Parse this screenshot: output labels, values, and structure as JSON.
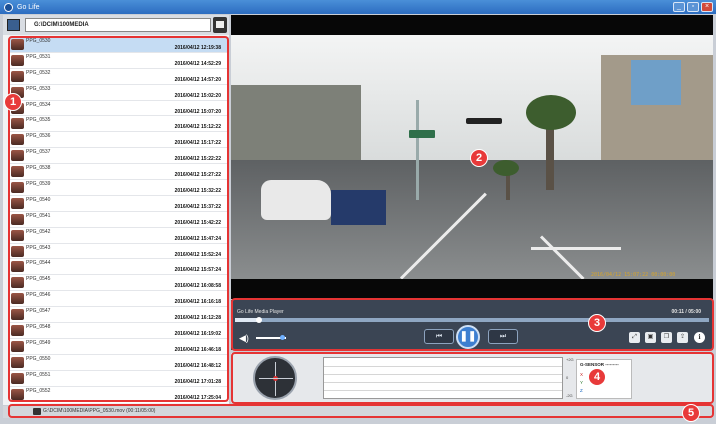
{
  "window": {
    "title": "Go Life",
    "controls": [
      "_",
      "▫",
      "×"
    ]
  },
  "directory": {
    "path": "G:\\DCIM\\100MEDIA"
  },
  "files": [
    {
      "name": "PPG_0530",
      "date": "2016/04/12 12:19:38"
    },
    {
      "name": "PPG_0531",
      "date": "2016/04/12 14:52:29"
    },
    {
      "name": "PPG_0532",
      "date": "2016/04/12 14:57:20"
    },
    {
      "name": "PPG_0533",
      "date": "2016/04/12 15:02:20"
    },
    {
      "name": "PPG_0534",
      "date": "2016/04/12 15:07:20"
    },
    {
      "name": "PPG_0535",
      "date": "2016/04/12 15:12:22"
    },
    {
      "name": "PPG_0536",
      "date": "2016/04/12 15:17:22"
    },
    {
      "name": "PPG_0537",
      "date": "2016/04/12 15:22:22"
    },
    {
      "name": "PPG_0538",
      "date": "2016/04/12 15:27:22"
    },
    {
      "name": "PPG_0539",
      "date": "2016/04/12 15:32:22"
    },
    {
      "name": "PPG_0540",
      "date": "2016/04/12 15:37:22"
    },
    {
      "name": "PPG_0541",
      "date": "2016/04/12 15:42:22"
    },
    {
      "name": "PPG_0542",
      "date": "2016/04/12 15:47:24"
    },
    {
      "name": "PPG_0543",
      "date": "2016/04/12 15:52:24"
    },
    {
      "name": "PPG_0544",
      "date": "2016/04/12 15:57:24"
    },
    {
      "name": "PPG_0545",
      "date": "2016/04/12 16:08:58"
    },
    {
      "name": "PPG_0546",
      "date": "2016/04/12 16:16:18"
    },
    {
      "name": "PPG_0547",
      "date": "2016/04/12 16:12:28"
    },
    {
      "name": "PPG_0548",
      "date": "2016/04/12 16:19:02"
    },
    {
      "name": "PPG_0549",
      "date": "2016/04/12 16:46:18"
    },
    {
      "name": "PPG_0550",
      "date": "2016/04/12 16:48:12"
    },
    {
      "name": "PPG_0551",
      "date": "2016/04/12 17:01:28"
    },
    {
      "name": "PPG_0552",
      "date": "2016/04/12 17:25:04"
    }
  ],
  "video": {
    "timestamp": "2016/04/12 15:07:22 00:00:00"
  },
  "player": {
    "title": "Go Life Media Player",
    "time": "00:11 / 05:00",
    "progress": 0.05,
    "volume": 0.85,
    "prev_label": "⏮",
    "play_label": "❚❚",
    "next_label": "⏭",
    "icons": [
      "fullscreen-icon",
      "snapshot-icon",
      "copy-icon",
      "export-icon",
      "info-icon"
    ]
  },
  "sensor": {
    "axis_top": "+2G",
    "axis_mid": "0",
    "axis_bot": "-2G",
    "gsensor_title": "G-SENSOR ---------",
    "x_label": "X",
    "y_label": "Y",
    "z_label": "Z"
  },
  "status": {
    "text": "G:\\DCIM\\100MEDIA\\PPG_0530.mov (00:11/05:00)"
  },
  "markers": [
    "1",
    "2",
    "3",
    "4",
    "5"
  ]
}
